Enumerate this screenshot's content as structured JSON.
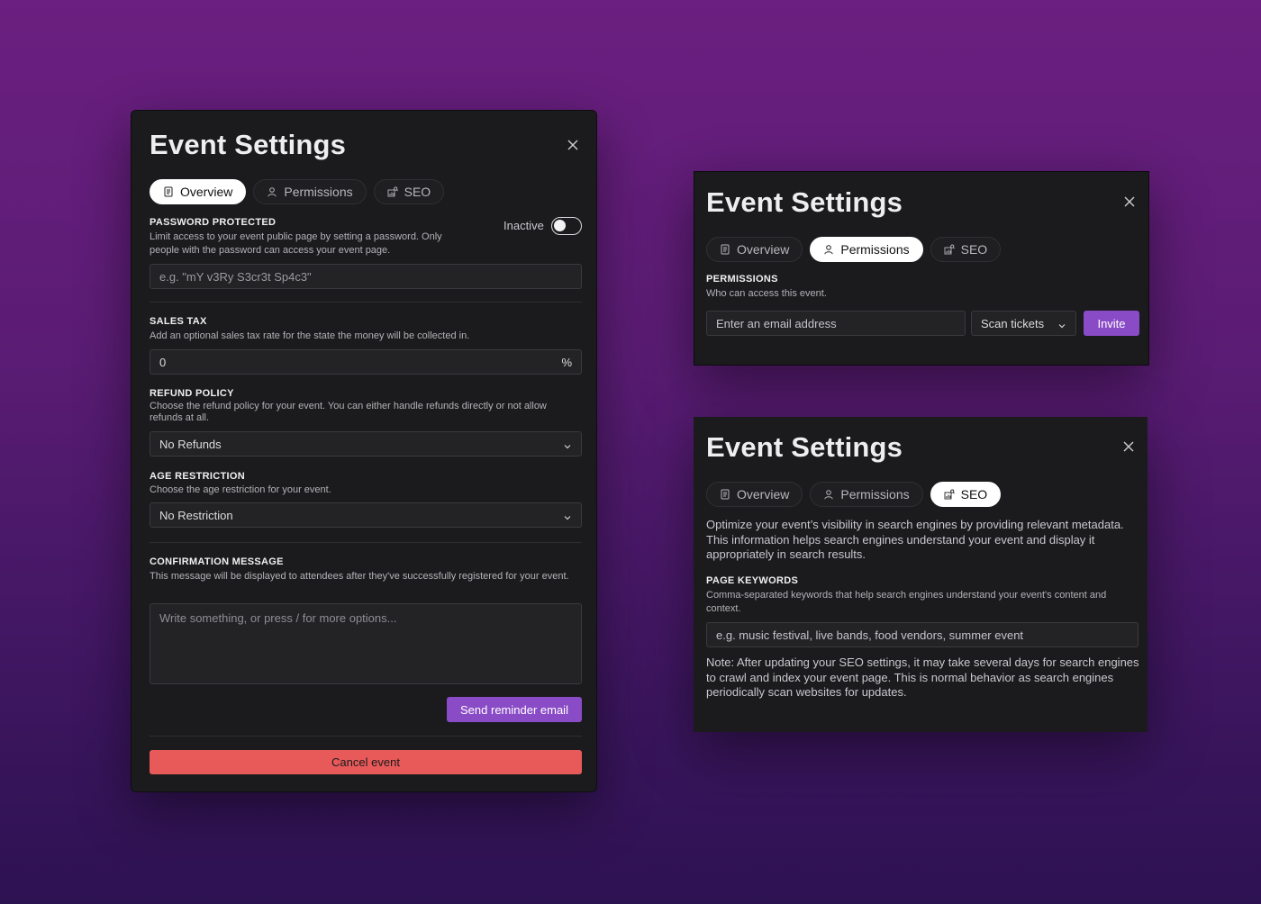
{
  "tab_labels": {
    "overview": "Overview",
    "permissions": "Permissions",
    "seo": "SEO"
  },
  "main": {
    "title": "Event Settings",
    "password": {
      "heading": "PASSWORD PROTECTED",
      "description": "Limit access to your event public page by setting a password. Only people with the password can access your event page.",
      "status": "Inactive",
      "toggle_on": false,
      "placeholder": "e.g. \"mY v3Ry S3cr3t Sp4c3\""
    },
    "sales_tax": {
      "heading": "SALES TAX",
      "description": "Add an optional sales tax rate for the state the money will be collected in.",
      "value": "0",
      "unit": "%"
    },
    "refund": {
      "heading": "REFUND POLICY",
      "description": "Choose the refund policy for your event. You can either handle refunds directly or not allow refunds at all.",
      "selected": "No Refunds"
    },
    "age": {
      "heading": "AGE RESTRICTION",
      "description": "Choose the age restriction for your event.",
      "selected": "No Restriction"
    },
    "confirmation": {
      "heading": "CONFIRMATION MESSAGE",
      "description": "This message will be displayed to attendees after they've successfully registered for your event.",
      "placeholder": "Write something, or press / for more options..."
    },
    "send_reminder_label": "Send reminder email",
    "cancel_label": "Cancel event"
  },
  "permissions_panel": {
    "title": "Event Settings",
    "heading": "PERMISSIONS",
    "description": "Who can access this event.",
    "email_placeholder": "Enter an email address",
    "role_selected": "Scan tickets",
    "invite_label": "Invite"
  },
  "seo_panel": {
    "title": "Event Settings",
    "intro": "Optimize your event’s visibility in search engines by providing relevant metadata. This information helps search engines understand your event and display it appropriately in search results.",
    "keywords_heading": "PAGE KEYWORDS",
    "keywords_description": "Comma-separated keywords that help search engines understand your event's content and context.",
    "keywords_placeholder": "e.g. music festival, live bands, food vendors, summer event",
    "note": "Note: After updating your SEO settings, it may take several days for search engines to crawl and index your event page. This is normal behavior as search engines periodically scan websites for updates."
  },
  "colors": {
    "accent_purple": "#8a4bc6",
    "danger_red": "#e85a5a",
    "panel_bg": "#1b1b1d",
    "background_top": "#6b1f80",
    "background_bottom": "#2d1252"
  },
  "icons": {
    "close": "close-icon",
    "overview": "document-icon",
    "permissions": "user-icon",
    "seo": "chart-search-icon",
    "dropdown": "chevron-down-icon"
  }
}
